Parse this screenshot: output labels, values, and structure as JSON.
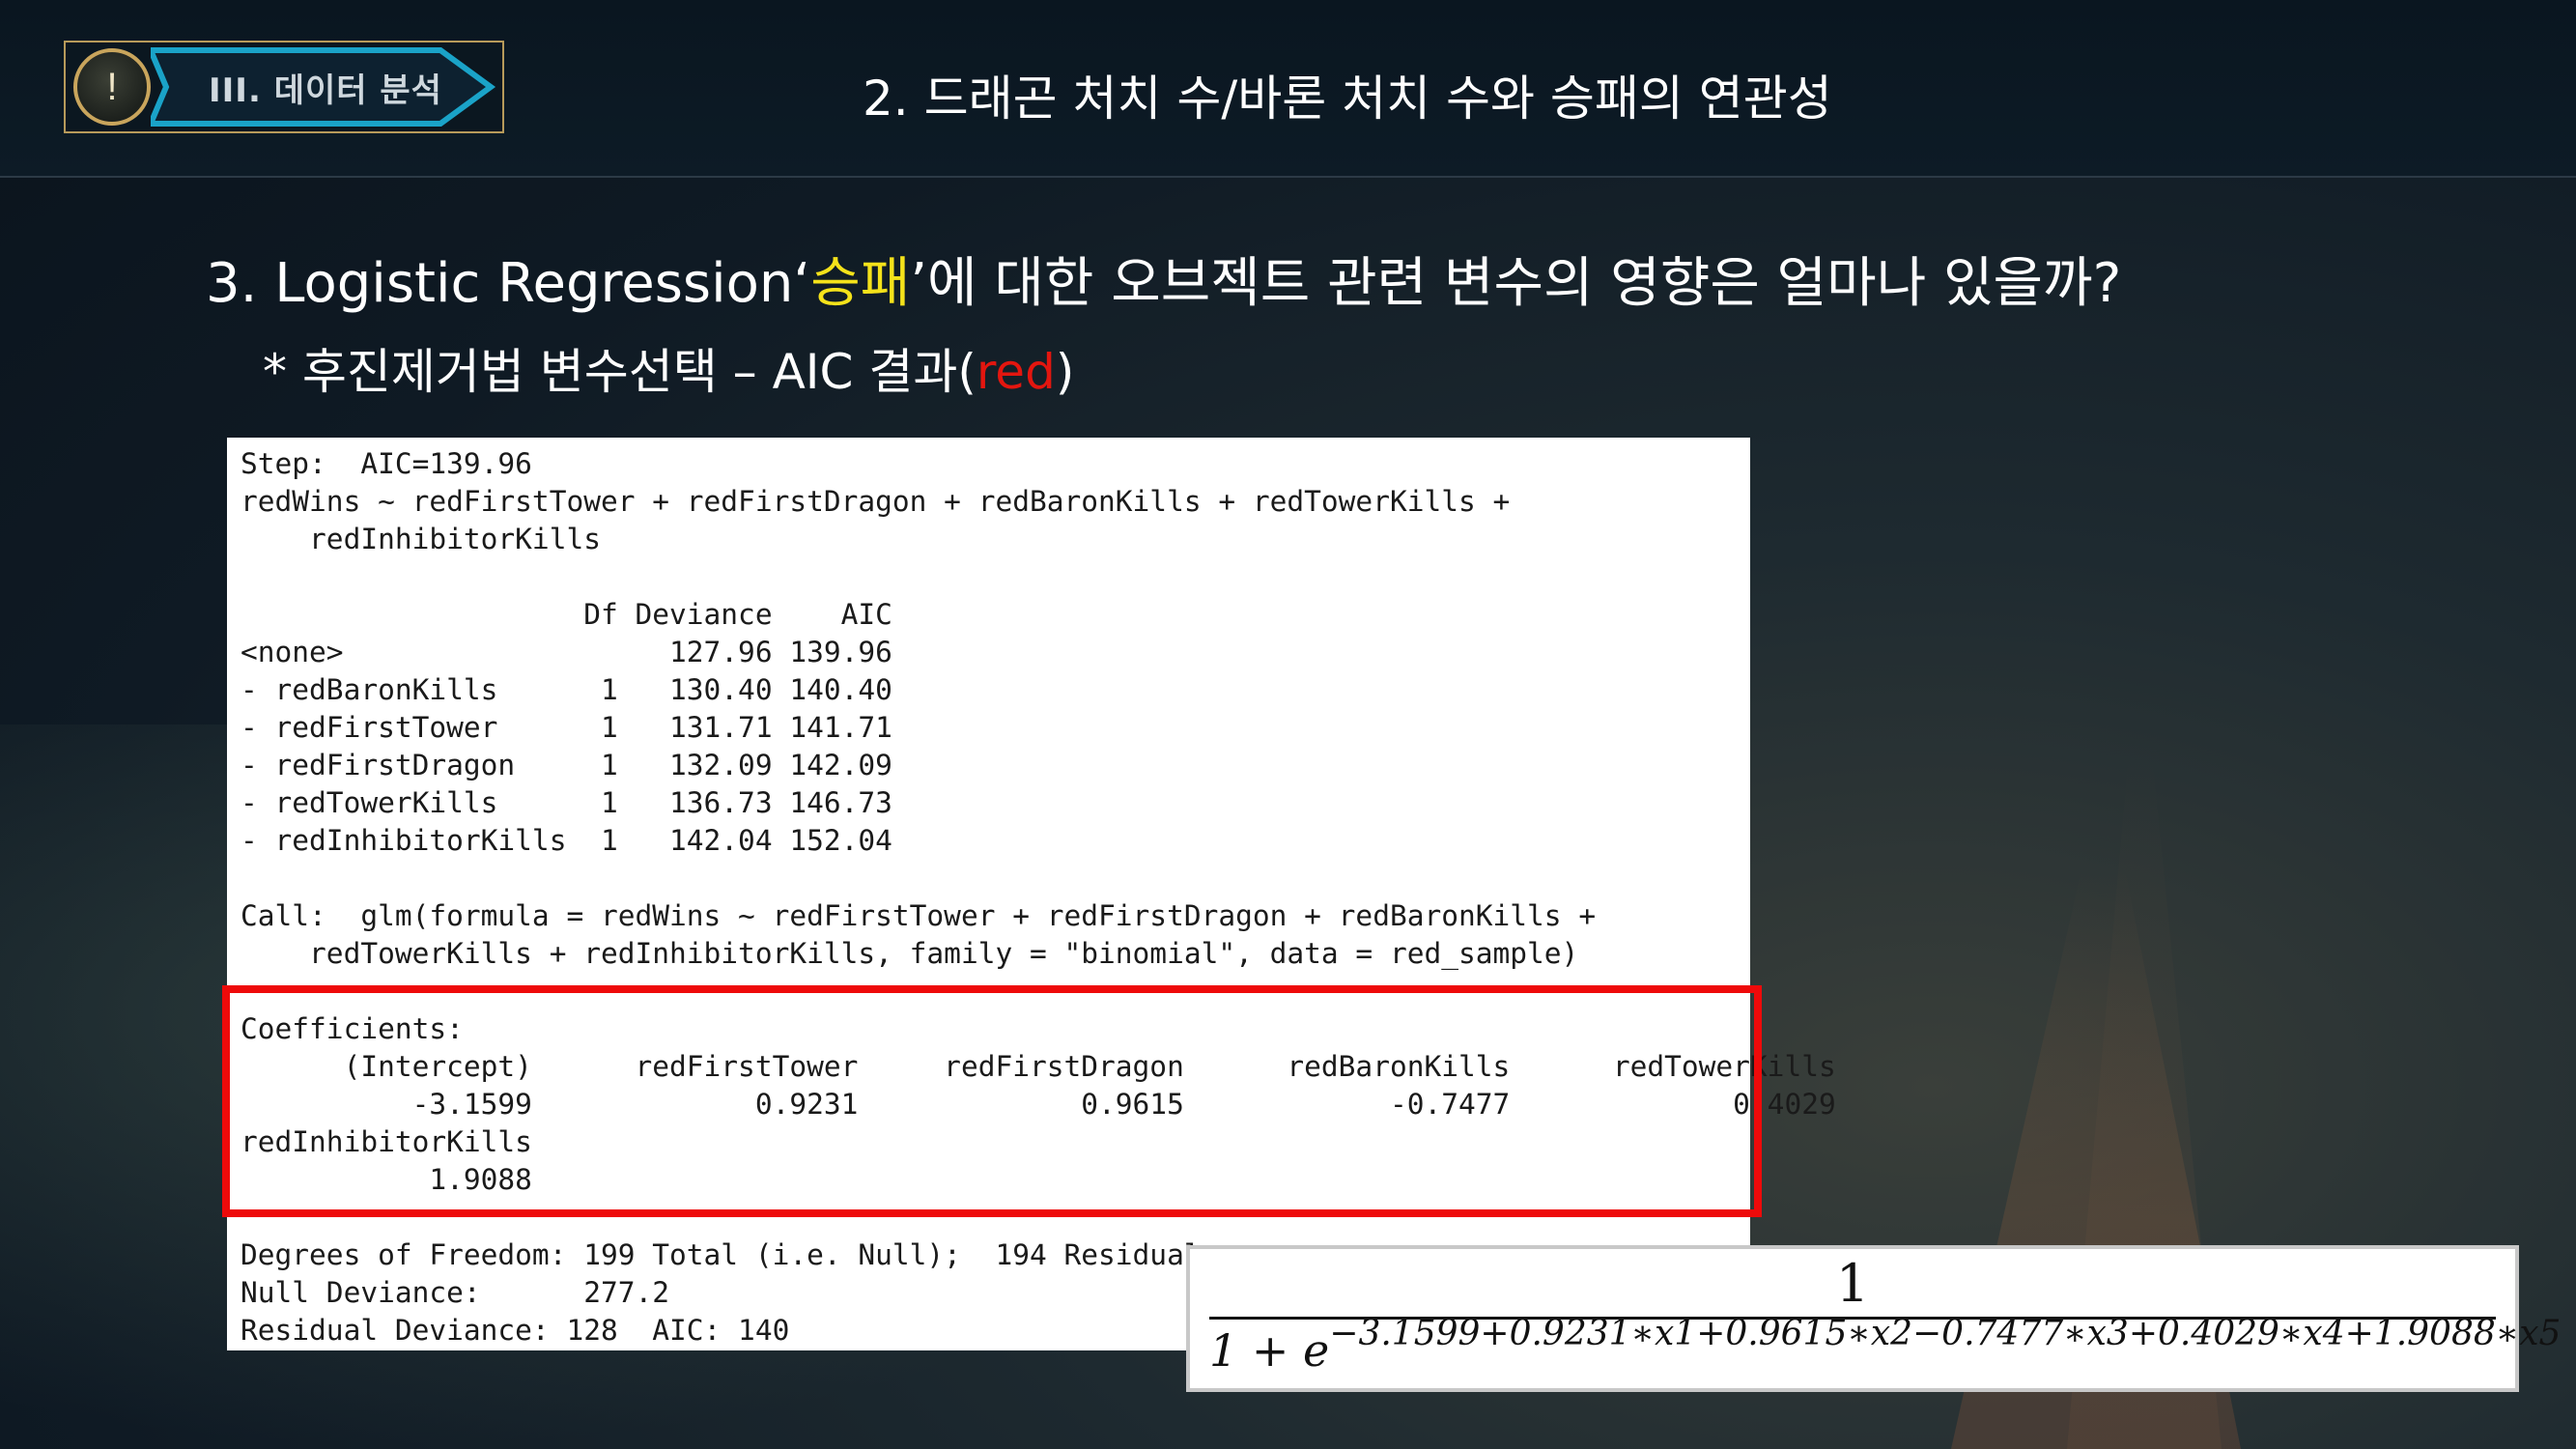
{
  "header": {
    "badge_icon": "exclamation-icon",
    "badge_icon_glyph": "!",
    "section_label": "III. 데이터 분석",
    "title": "2. 드래곤 처치 수/바론 처치 수와 승패의 연관성"
  },
  "heading": {
    "prefix": "3. Logistic Regression‘",
    "highlight": "승패",
    "suffix": "’에 대한 오브젝트 관련 변수의 영향은 얼마나 있을까?"
  },
  "subheading": {
    "prefix": "* 후진제거법 변수선택 – AIC 결과(",
    "highlight": "red",
    "suffix": ")"
  },
  "console": {
    "text": "Step:  AIC=139.96\nredWins ~ redFirstTower + redFirstDragon + redBaronKills + redTowerKills +\n    redInhibitorKills\n\n                    Df Deviance    AIC\n<none>                   127.96 139.96\n- redBaronKills      1   130.40 140.40\n- redFirstTower      1   131.71 141.71\n- redFirstDragon     1   132.09 142.09\n- redTowerKills      1   136.73 146.73\n- redInhibitorKills  1   142.04 152.04\n\nCall:  glm(formula = redWins ~ redFirstTower + redFirstDragon + redBaronKills +\n    redTowerKills + redInhibitorKills, family = \"binomial\", data = red_sample)\n\nCoefficients:\n      (Intercept)      redFirstTower     redFirstDragon      redBaronKills      redTowerKills\n          -3.1599             0.9231             0.9615            -0.7477             0.4029\nredInhibitorKills\n           1.9088\n\nDegrees of Freedom: 199 Total (i.e. Null);  194 Residual\nNull Deviance:      277.2\nResidual Deviance: 128  AIC: 140"
  },
  "formula": {
    "numerator": "1",
    "base": "1 + e",
    "exponent": "−3.1599+0.9231∗x1+0.9615∗x2−0.7477∗x3+0.4029∗x4+1.9088∗x5"
  },
  "colors": {
    "highlight_yellow": "#f5e21a",
    "highlight_red": "#e3160f",
    "box_red": "#ee0a0a",
    "badge_gold": "#c9a55c",
    "badge_cyan": "#1aa3c8"
  }
}
